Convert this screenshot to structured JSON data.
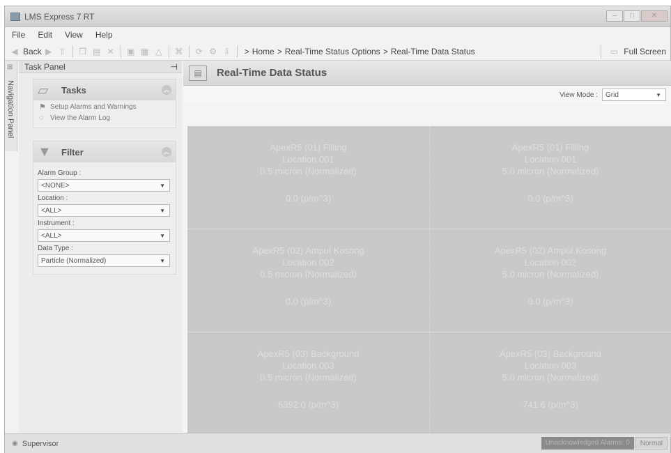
{
  "window": {
    "title": "LMS Express 7 RT"
  },
  "menu": {
    "items": [
      "File",
      "Edit",
      "View",
      "Help"
    ]
  },
  "toolbar": {
    "back_label": "Back",
    "breadcrumb": [
      "Home",
      "Real-Time Status Options",
      "Real-Time Data Status"
    ],
    "fullscreen_label": "Full Screen"
  },
  "nav_panel": {
    "label": "Navigation Panel"
  },
  "task_panel": {
    "title": "Task Panel",
    "tasks": {
      "title": "Tasks",
      "items": [
        "Setup Alarms and Warnings",
        "View the Alarm Log"
      ]
    },
    "filter": {
      "title": "Filter",
      "fields": [
        {
          "label": "Alarm Group :",
          "value": "<NONE>"
        },
        {
          "label": "Location :",
          "value": "<ALL>"
        },
        {
          "label": "Instrument :",
          "value": "<ALL>"
        },
        {
          "label": "Data Type :",
          "value": "Particle (Normalized)"
        }
      ]
    }
  },
  "main": {
    "title": "Real-Time Data Status",
    "view_mode_label": "View Mode :",
    "view_mode_value": "Grid",
    "cells": [
      {
        "instrument": "ApexR5 (01) Filling",
        "location": "Location 001",
        "channel": "0.5 micron (Normalized)",
        "value": "0.0 (p/m^3)"
      },
      {
        "instrument": "ApexR5 (01) Filling",
        "location": "Location 001",
        "channel": "5.0 micron (Normalized)",
        "value": "0.0 (p/m^3)"
      },
      {
        "instrument": "ApexR5 (02) Ampul Kosong",
        "location": "Location 002",
        "channel": "0.5 micron (Normalized)",
        "value": "0.0 (p/m^3)"
      },
      {
        "instrument": "ApexR5 (02) Ampul Kosong",
        "location": "Location 002",
        "channel": "5.0 micron (Normalized)",
        "value": "0.0 (p/m^3)"
      },
      {
        "instrument": "ApexR5 (03) Background",
        "location": "Location 003",
        "channel": "0.5 micron (Normalized)",
        "value": "6392.0 (p/m^3)"
      },
      {
        "instrument": "ApexR5 (03) Background",
        "location": "Location 003",
        "channel": "5.0 micron (Normalized)",
        "value": "741.6 (p/m^3)"
      }
    ]
  },
  "statusbar": {
    "user": "Supervisor",
    "alarm_label": "Unacknowledged Alarms: 0",
    "mode_label": "Normal"
  },
  "colors": {
    "cell_bg": "#c9c9c9",
    "cell_text": "#dedede",
    "panel_bg": "#ececec"
  }
}
